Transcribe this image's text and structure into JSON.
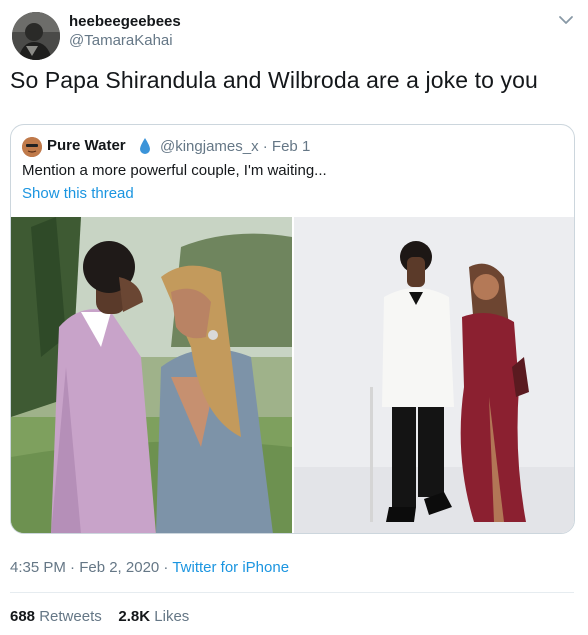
{
  "author": {
    "display_name": "heebeegeebees",
    "handle": "@TamaraKahai"
  },
  "tweet": {
    "text": "So Papa Shirandula and Wilbroda are a joke to you"
  },
  "quoted": {
    "display_name": "Pure Water",
    "meta": "@kingjames_x · Feb 1",
    "text": "Mention a more powerful couple, I'm waiting...",
    "thread_link": "Show this thread"
  },
  "footer": {
    "time_date": "4:35 PM · Feb 2, 2020 · ",
    "source": "Twitter for iPhone"
  },
  "stats": {
    "retweets_count": "688",
    "retweets_label": "Retweets",
    "likes_count": "2.8K",
    "likes_label": "Likes"
  },
  "colors": {
    "link": "#1b95e0",
    "secondary_text": "#657786",
    "primary_text": "#14171a",
    "border": "#ccd6dd"
  },
  "icons": {
    "menu": "chevron-down-icon",
    "verified_like_emoji": "droplet-icon"
  }
}
